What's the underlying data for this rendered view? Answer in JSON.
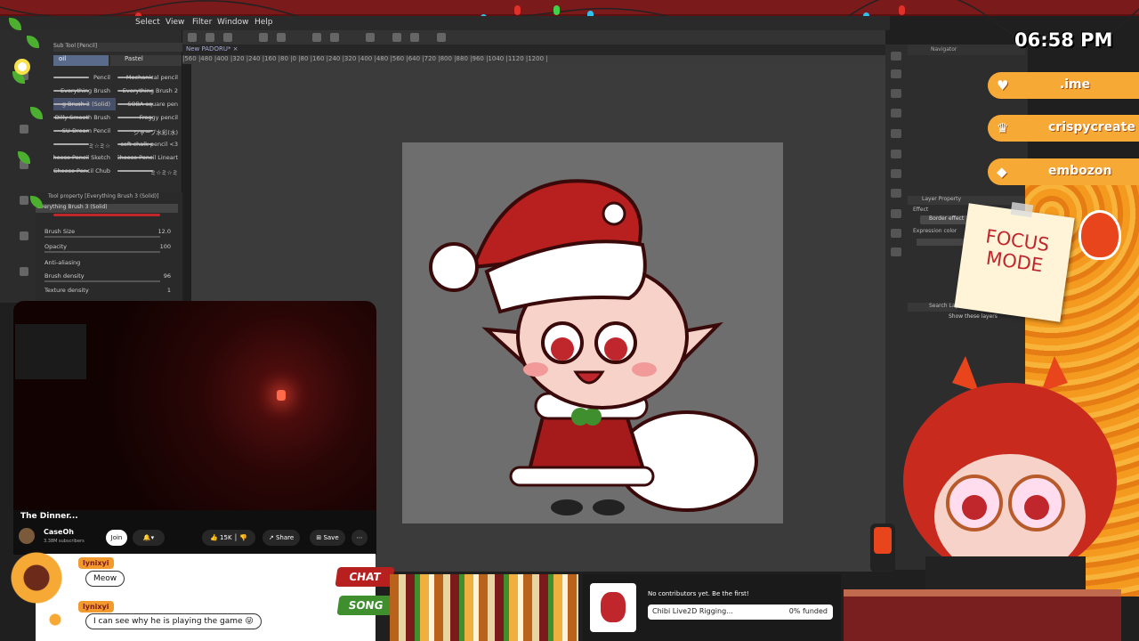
{
  "app": {
    "menu": [
      "Select",
      "View",
      "Filter",
      "Window",
      "Help"
    ],
    "document_tab": "New PADORU* ×",
    "ruler_text": "|560  |480  |400  |320  |240  |160  |80   |0    |80   |160  |240  |320  |400  |480  |560  |640  |720  |800  |880  |960  |1040 |1120 |1200 |"
  },
  "subtool_panel": {
    "title": "Sub Tool [Pencil]",
    "tabs": [
      "oil",
      "Pastel"
    ],
    "brushes_left": [
      "Pencil",
      "Everything Brush",
      "g Brush 3 (Solid)",
      "Dilly Smooth Brush",
      "SU-Dream Pencil",
      "ミ☆ミ☆",
      "Cheese Pencil Sketch",
      "Cheese Pencil Chub"
    ],
    "brushes_right": [
      "Mechanical pencil",
      "Everything Brush 2",
      "SOBA square pen",
      "Froggy pencil",
      "シャープ水彩(水)",
      "soft chalk pencil <3",
      "Cheese Pencil Lineart",
      "ミ☆ミ☆ミ"
    ]
  },
  "tool_property": {
    "title": "Tool property [Everything Brush 3 (Solid)]",
    "brush_name": "Everything Brush 3 (Solid)",
    "rows": [
      {
        "label": "Brush Size",
        "value": "12.0"
      },
      {
        "label": "Opacity",
        "value": "100"
      },
      {
        "label": "Anti-aliasing",
        "value": ""
      },
      {
        "label": "Brush density",
        "value": "96"
      },
      {
        "label": "Texture density",
        "value": "1"
      }
    ]
  },
  "right_dock": {
    "navigator": "Navigator",
    "layer_property": "Layer Property",
    "effect": "Effect",
    "border_effect": "Border effect",
    "expression_color": "Expression color",
    "search_layer": "Search Layer",
    "show_these_layers": "Show these layers"
  },
  "video": {
    "title": "The Dinner...",
    "channel": "CaseOh",
    "subscribers": "3.38M subscribers",
    "join": "Join",
    "likes": "15K",
    "share": "Share",
    "save": "Save"
  },
  "chat": {
    "messages": [
      {
        "user": "lynixyi",
        "text": "Meow"
      },
      {
        "user": "lynixyi",
        "text": "I can see why he is playing the game 😜"
      }
    ]
  },
  "buttons": {
    "chat": "CHAT",
    "song": "SONG"
  },
  "contributions": {
    "notice": "No contributors yet. Be the first!",
    "goal_name": "Chibi Live2D Rigging...",
    "funded": "0% funded",
    "funded_fraction": 0
  },
  "clock": "06:58 PM",
  "socials": [
    {
      "icon": "heart-icon",
      "label": ".ime"
    },
    {
      "icon": "crown-icon",
      "label": "crispycreate"
    },
    {
      "icon": "diamond-icon",
      "label": "embozon"
    }
  ],
  "focus_note": "FOCUS MODE",
  "colors": {
    "santa_red": "#c0272d",
    "accent_orange": "#f7a935",
    "frame_red": "#7a1a1a",
    "song_green": "#3f8f2e"
  }
}
